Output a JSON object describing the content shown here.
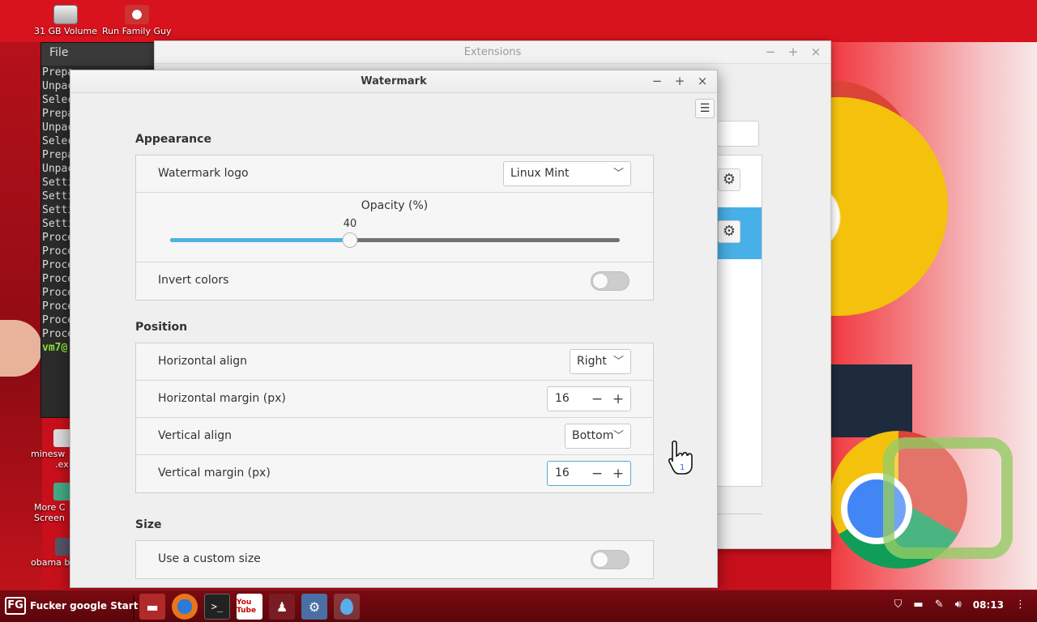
{
  "desktop": {
    "icons": [
      {
        "label": "31 GB Volume"
      },
      {
        "label": "Run Family Guy"
      }
    ],
    "side_labels": [
      "minesw",
      ".ex",
      "More C",
      "Screen",
      "obama b"
    ]
  },
  "terminal": {
    "menu": [
      "File"
    ],
    "lines": [
      "Prepa",
      "Unpac",
      "Selec",
      "Prepa",
      "Unpac",
      "Selec",
      "Prepa",
      "Unpac",
      "Setti",
      "Setti",
      "Setti",
      "Setti",
      "Proce",
      "Proce",
      "Proce",
      "Proce",
      "Proce",
      "Proce",
      "Proce",
      "Proce",
      "vm7@"
    ]
  },
  "extensions_window": {
    "title": "Extensions"
  },
  "watermark_window": {
    "title": "Watermark",
    "appearance": {
      "heading": "Appearance",
      "logo_label": "Watermark logo",
      "logo_value": "Linux Mint",
      "opacity_label": "Opacity (%)",
      "opacity_value": 40,
      "opacity_value_text": "40",
      "invert_label": "Invert colors",
      "invert_on": false
    },
    "position": {
      "heading": "Position",
      "h_align_label": "Horizontal align",
      "h_align_value": "Right",
      "h_margin_label": "Horizontal margin (px)",
      "h_margin_value": "16",
      "v_align_label": "Vertical align",
      "v_align_value": "Bottom",
      "v_margin_label": "Vertical margin (px)",
      "v_margin_value": "16"
    },
    "size": {
      "heading": "Size",
      "custom_label": "Use a custom size",
      "custom_on": false
    }
  },
  "taskbar": {
    "start_label": "Fucker google Start",
    "start_badge": "FG",
    "launchers": [
      "files-icon",
      "firefox-icon",
      "terminal-icon",
      "youtube-icon",
      "family-guy-icon",
      "settings-icon",
      "watermark-icon"
    ],
    "youtube_text": "You Tube",
    "clock": "08:13"
  },
  "colors": {
    "accent": "#4fb2e3",
    "desktop_red": "#d8131d",
    "taskbar": "#6a0810"
  }
}
